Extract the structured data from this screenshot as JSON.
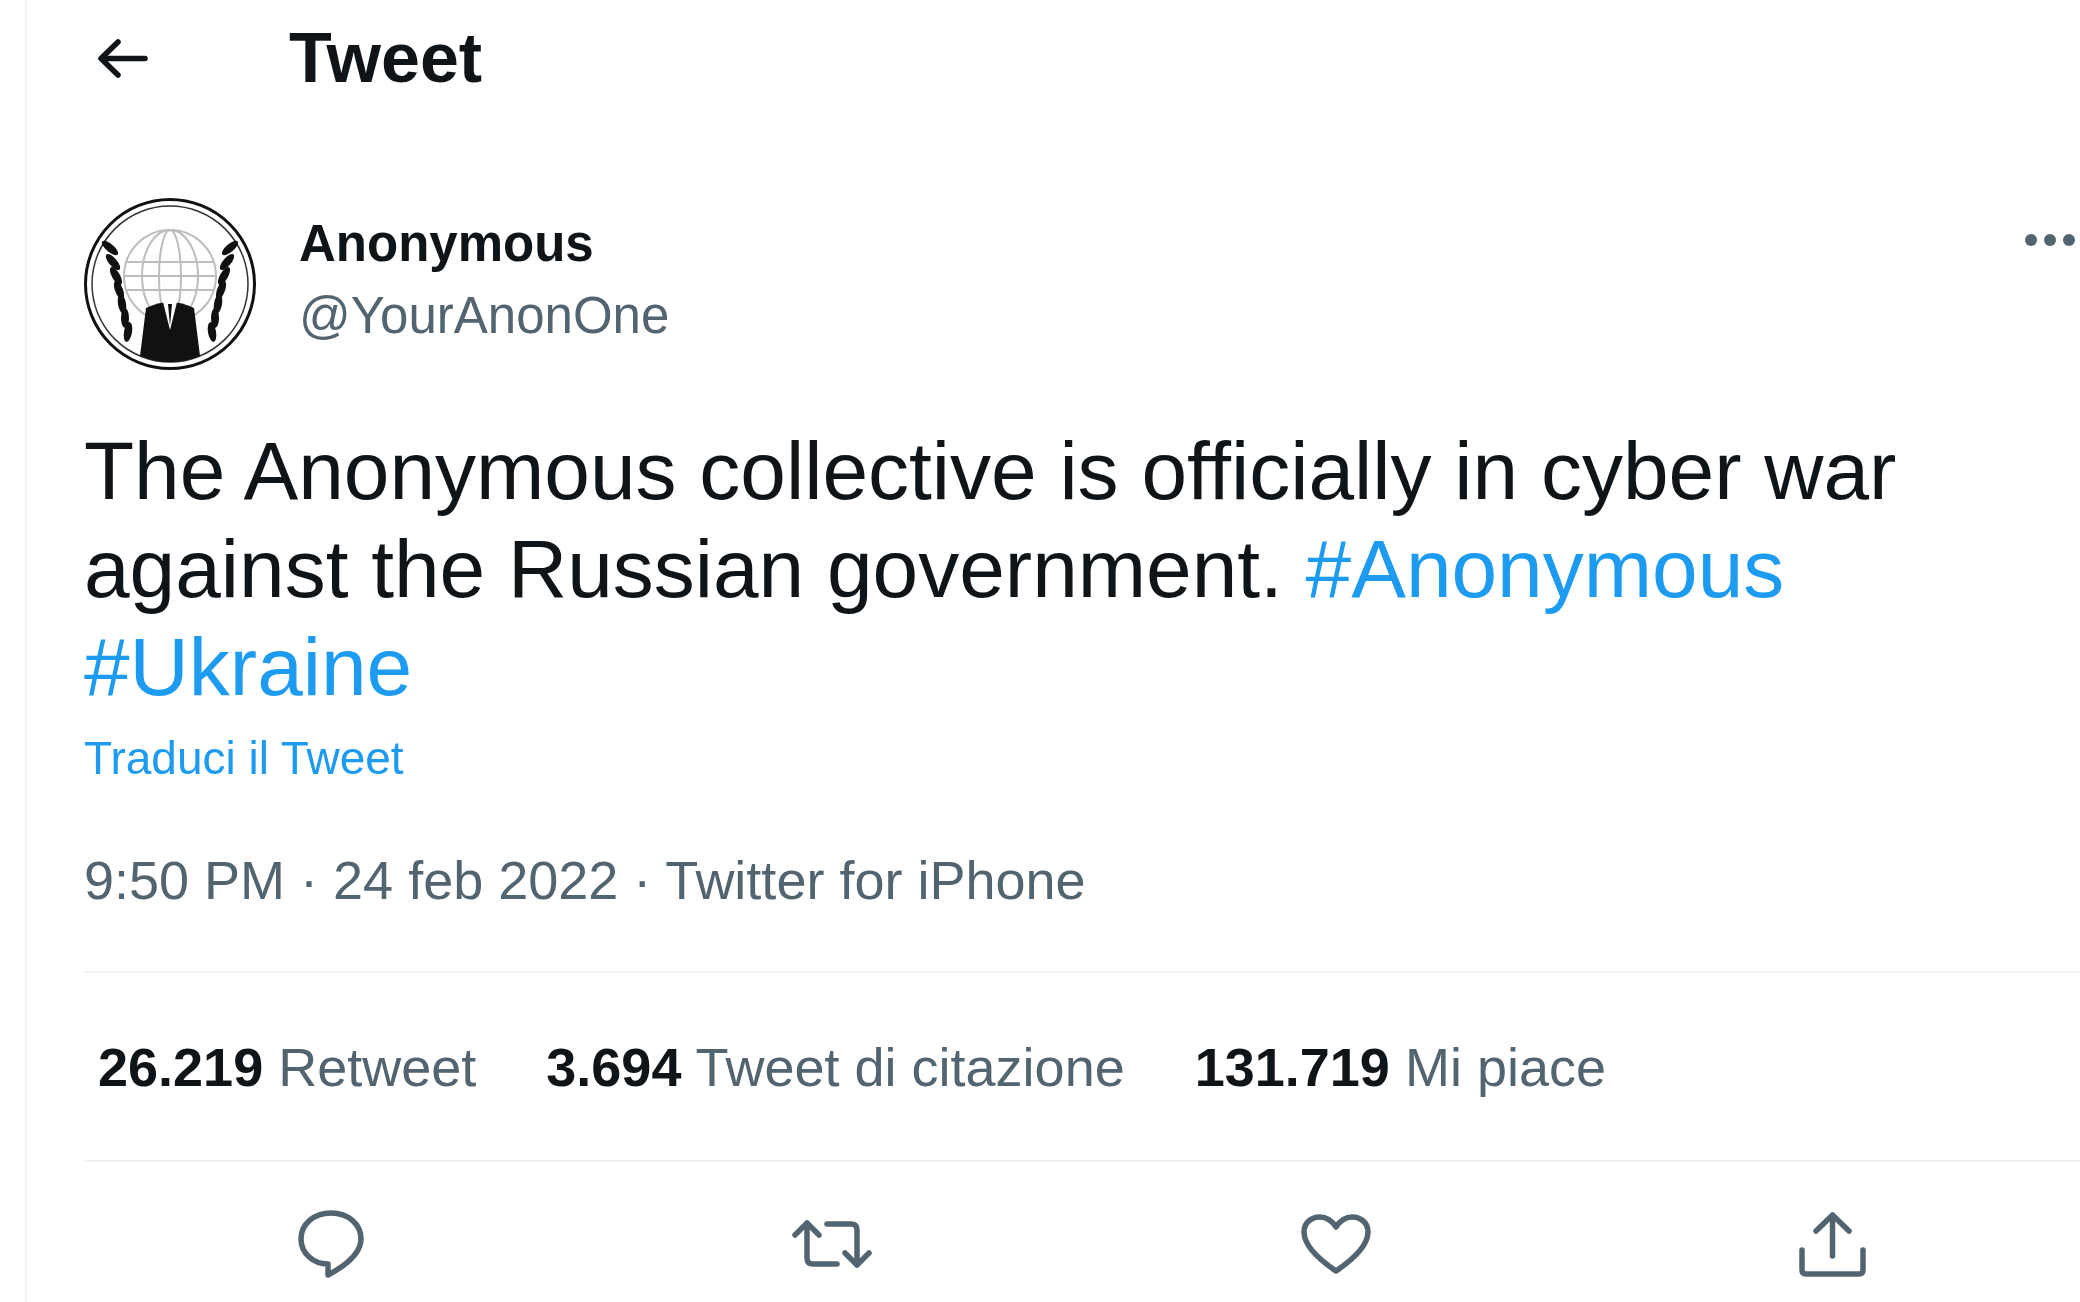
{
  "header": {
    "title": "Tweet"
  },
  "tweet": {
    "author": {
      "name": "Anonymous",
      "handle": "@YourAnonOne"
    },
    "text": [
      {
        "kind": "plain",
        "text": "The Anonymous collective is officially in cyber war against the Russian government."
      },
      {
        "kind": "hashtag",
        "text": "#Anonymous"
      },
      {
        "kind": "hashtag",
        "text": "#Ukraine"
      }
    ],
    "translate_link": "Traduci il Tweet",
    "meta": "9:50 PM · 24 feb 2022 · Twitter for iPhone",
    "stats": [
      {
        "count": "26.219",
        "label": "Retweet"
      },
      {
        "count": "3.694",
        "label": "Tweet di citazione"
      },
      {
        "count": "131.719",
        "label": "Mi piace"
      }
    ]
  }
}
